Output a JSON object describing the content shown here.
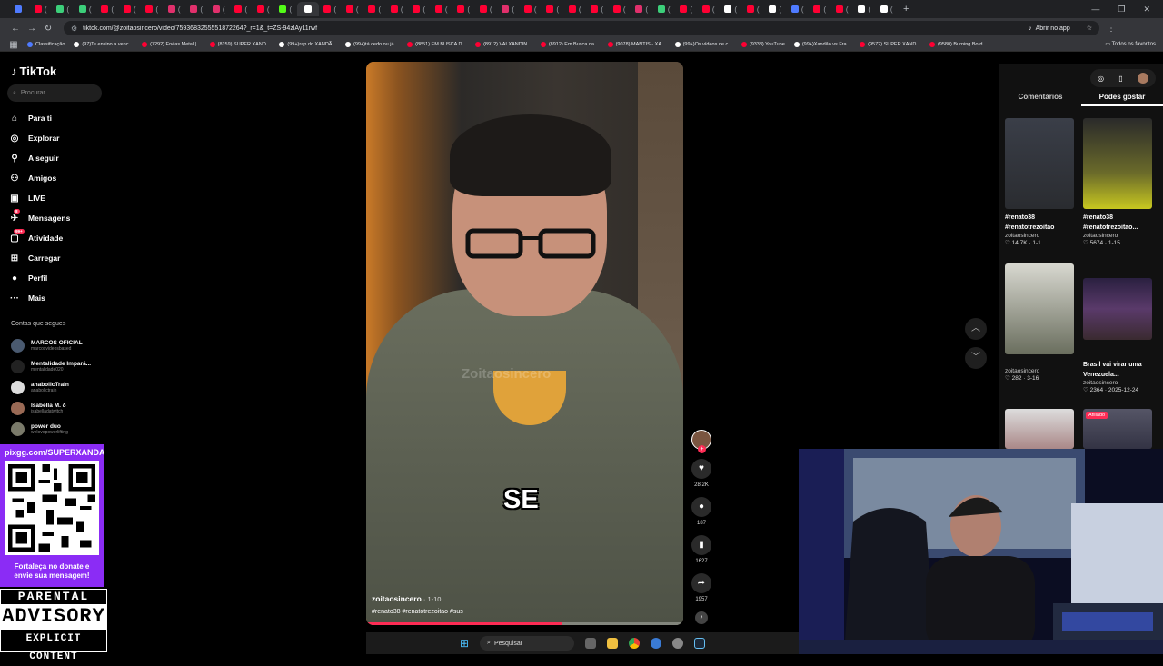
{
  "browser": {
    "url": "tiktok.com/@zoitaosincero/video/7593683255551872264?_r=1&_t=ZS-94zlAy11rwf",
    "open_in_app": "Abrir no app",
    "bookmarks": [
      "Classificação",
      "(97)Te ensino a venc...",
      "(7292) Enéas Metal |...",
      "(8159) SUPER XAND...",
      "(99+)rap do XANDÃ...",
      "(99+)tá cedo ou já...",
      "(8851) EM BUSCA D...",
      "(8912) VAI XANDIN...",
      "(8912) Em Busca da...",
      "(9078) MANTIS - XA...",
      "(99+)Os vídeos de c...",
      "(9338) YouTube",
      "(99+)Xandão vs Fra...",
      "(9572) SUPER XAND...",
      "(9580) Burning Bord..."
    ],
    "bookmarks_all": "Todos os favoritos"
  },
  "sidebar": {
    "logo": "TikTok",
    "search_placeholder": "Procurar",
    "nav": [
      {
        "label": "Para ti",
        "icon": "home-icon"
      },
      {
        "label": "Explorar",
        "icon": "compass-icon"
      },
      {
        "label": "A seguir",
        "icon": "following-icon"
      },
      {
        "label": "Amigos",
        "icon": "friends-icon"
      },
      {
        "label": "LIVE",
        "icon": "live-icon"
      },
      {
        "label": "Mensagens",
        "icon": "messages-icon",
        "badge": "8"
      },
      {
        "label": "Atividade",
        "icon": "activity-icon",
        "badge": "99+"
      },
      {
        "label": "Carregar",
        "icon": "upload-icon"
      },
      {
        "label": "Perfil",
        "icon": "profile-icon"
      },
      {
        "label": "Mais",
        "icon": "more-icon"
      }
    ],
    "following_title": "Contas que segues",
    "following": [
      {
        "name": "MARCOS OFICIAL",
        "handle": "marcosvideosbased"
      },
      {
        "name": "Mentalidade Impará...",
        "handle": "mentalidade020"
      },
      {
        "name": "anabolicTrain",
        "handle": "anabolictrain"
      },
      {
        "name": "Isabella M. δ",
        "handle": "isabelladatwitch"
      },
      {
        "name": "power duo",
        "handle": "welovepowerlifting"
      }
    ]
  },
  "overlay": {
    "donate_url": "pixgg.com/SUPERXANDAO",
    "donate_msg1": "Fortaleça no donate e",
    "donate_msg2": "envie sua mensagem!",
    "advisory1": "PARENTAL",
    "advisory2": "ADVISORY",
    "advisory3": "EXPLICIT CONTENT"
  },
  "video": {
    "watermark": "Zoitaosincero",
    "caption": "SE",
    "username": "zoitaosincero",
    "date": " · 1-10",
    "tags": "#renato38 #renatotrezoitao #sus",
    "progress": 0.62
  },
  "actions": {
    "likes": "28.2K",
    "comments": "187",
    "saves": "1627",
    "shares": "1957"
  },
  "right_panel": {
    "tab_comments": "Comentários",
    "tab_suggested": "Podes gostar",
    "cards": [
      {
        "title1": "#renato38",
        "title2": "#renatotrezoitao",
        "user": "zoitaosincero",
        "stats": "♡ 14.7K · 1-1"
      },
      {
        "title1": "#renato38",
        "title2": "#renatotrezoitao...",
        "user": "zoitaosincero",
        "stats": "♡ 5674 · 1-15"
      },
      {
        "title1": "",
        "title2": "",
        "user": "zoitaosincero",
        "stats": "♡ 282 · 3-16"
      },
      {
        "title1": "Brasil vai virar uma",
        "title2": "Venezuela...",
        "user": "zoitaosincero",
        "stats": "♡ 2364 · 2025-12-24"
      }
    ],
    "afiliado": "Afiliado"
  },
  "taskbar": {
    "search": "Pesquisar"
  },
  "colors": {
    "accent": "#fe2c55",
    "donate_bg": "#8b2cf5"
  }
}
